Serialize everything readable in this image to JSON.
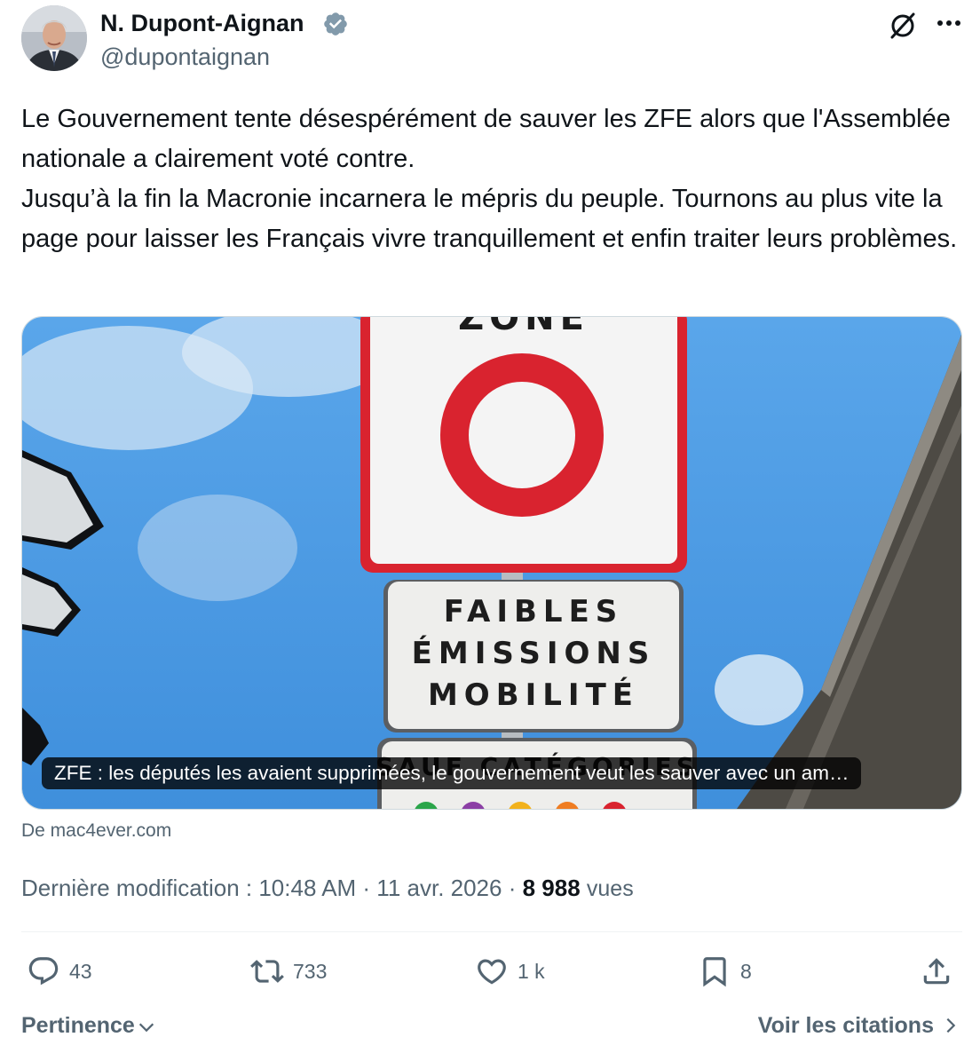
{
  "author": {
    "name": "N. Dupont-Aignan",
    "handle": "@dupontaignan",
    "verified": true
  },
  "tweet": {
    "text": "Le Gouvernement tente désespérément de sauver les ZFE alors que l'Assemblée nationale a clairement voté contre.\nJusqu’à la fin la Macronie incarnera le mépris du peuple. Tournons au plus vite la page pour laisser les Français vivre tranquillement et enfin traiter leurs problèmes."
  },
  "card": {
    "caption": "ZFE : les députés les avaient supprimées, le gouvernement veut les sauver avec un am…",
    "source": "De mac4ever.com",
    "sign": {
      "top_partial": "ZONE",
      "line1": "FAIBLES",
      "line2": "ÉMISSIONS",
      "line3": "MOBILITÉ",
      "lower_partial": "SAUF CATÉGORIES"
    }
  },
  "meta": {
    "prefix": "Dernière modification : 10:48 AM · 11 avr. 2026 · ",
    "views_count": "8 988",
    "views_label": "vues"
  },
  "actions": {
    "replies": "43",
    "reposts": "733",
    "likes": "1 k",
    "bookmarks": "8"
  },
  "footer": {
    "sort_label": "Pertinence",
    "quotes_label": "Voir les citations"
  },
  "colors": {
    "text_primary": "#0f1419",
    "text_secondary": "#536471",
    "verified_badge": "#829aab",
    "sign_red": "#d9232f",
    "sky": "#4d9ce6"
  }
}
